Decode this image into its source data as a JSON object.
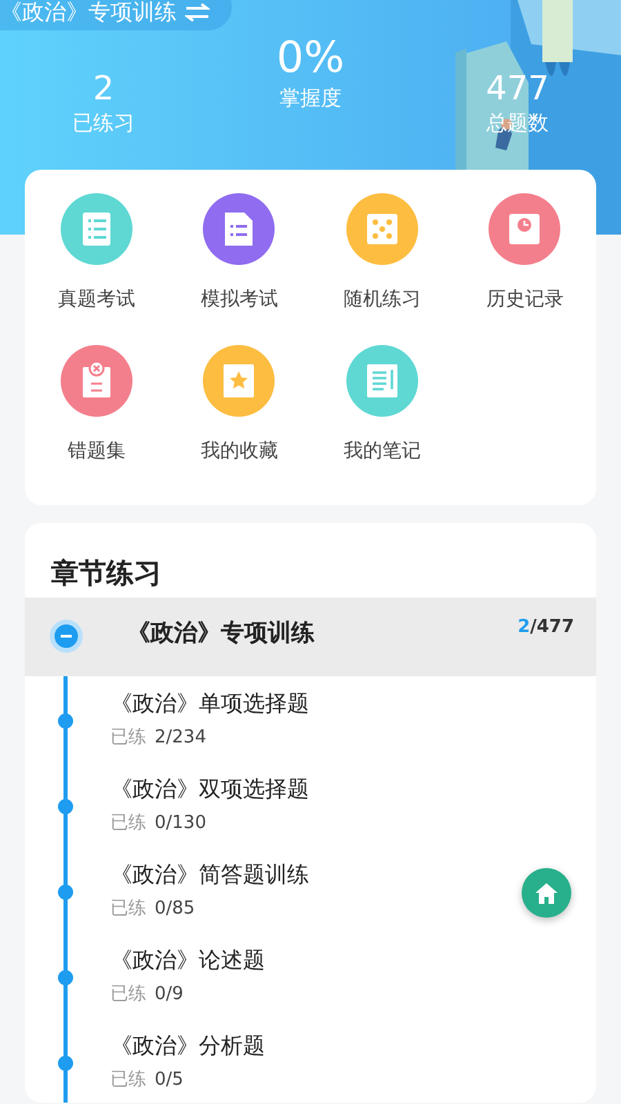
{
  "header": {
    "subject": "《政治》专项训练",
    "stats": [
      {
        "value": "2",
        "label": "已练习",
        "kind": "side"
      },
      {
        "value": "0%",
        "label": "掌握度",
        "kind": "main"
      },
      {
        "value": "477",
        "label": "总题数",
        "kind": "side"
      }
    ]
  },
  "tools": [
    {
      "label": "真题考试",
      "kind": "list",
      "color": "#5fd8d3"
    },
    {
      "label": "模拟考试",
      "kind": "file",
      "color": "#8f6cf0"
    },
    {
      "label": "随机练习",
      "kind": "dice",
      "color": "#fdbd41"
    },
    {
      "label": "历史记录",
      "kind": "clock",
      "color": "#f47f8c"
    },
    {
      "label": "错题集",
      "kind": "wrong",
      "color": "#f47f8c"
    },
    {
      "label": "我的收藏",
      "kind": "star",
      "color": "#fdbd41"
    },
    {
      "label": "我的笔记",
      "kind": "note",
      "color": "#5fd8d3"
    }
  ],
  "chapters": {
    "title": "章节练习",
    "items": [
      {
        "title": "《政治》专项训练",
        "done": "2",
        "total": "/477",
        "expanded": true,
        "children": [
          {
            "title": "《政治》单项选择题",
            "progress_label": "已练",
            "progress": "2/234"
          },
          {
            "title": "《政治》双项选择题",
            "progress_label": "已练",
            "progress": "0/130"
          },
          {
            "title": "《政治》简答题训练",
            "progress_label": "已练",
            "progress": "0/85"
          },
          {
            "title": "《政治》论述题",
            "progress_label": "已练",
            "progress": "0/9"
          },
          {
            "title": "《政治》分析题",
            "progress_label": "已练",
            "progress": "0/5"
          }
        ]
      }
    ]
  }
}
